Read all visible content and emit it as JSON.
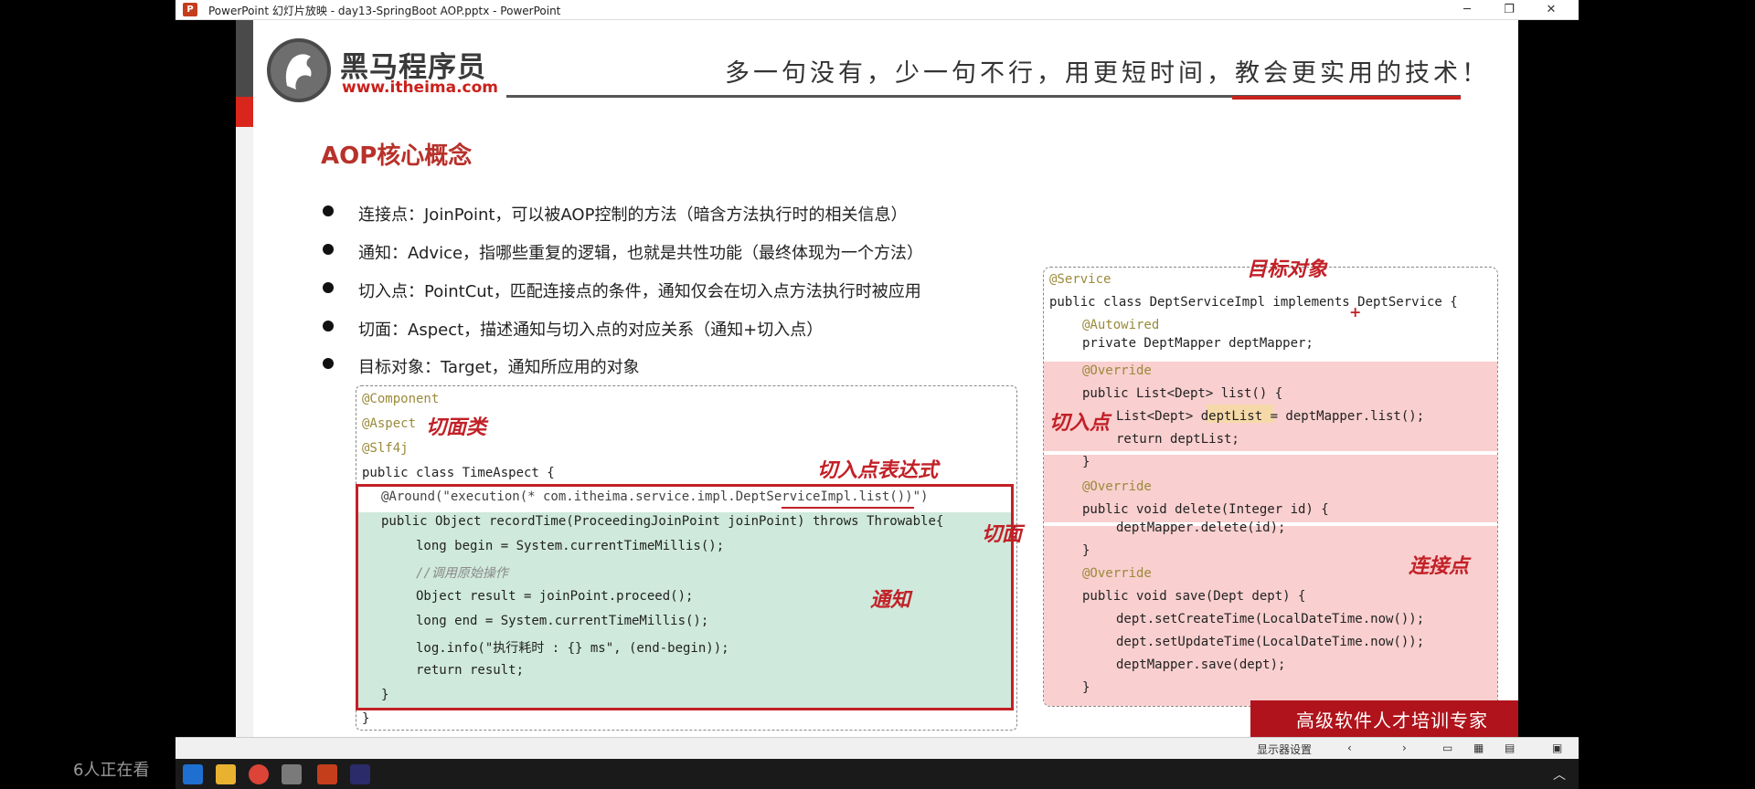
{
  "window": {
    "title": "PowerPoint 幻灯片放映  -  day13-SpringBoot AOP.pptx  -  PowerPoint",
    "minimize": "─",
    "restore": "❐",
    "close": "✕"
  },
  "slide": {
    "logo_cn": "黑马程序员",
    "logo_url": "www.itheima.com",
    "slogan": "多一句没有，少一句不行，用更短时间，教会更实用的技术！",
    "heading": "AOP核心概念",
    "bullets": [
      "连接点：JoinPoint，可以被AOP控制的方法（暗含方法执行时的相关信息）",
      "通知：Advice，指哪些重复的逻辑，也就是共性功能（最终体现为一个方法）",
      "切入点：PointCut，匹配连接点的条件，通知仅会在切入点方法执行时被应用",
      "切面：Aspect，描述通知与切入点的对应关系（通知+切入点）",
      "目标对象：Target，通知所应用的对象"
    ],
    "code_left": {
      "lines": [
        "@Component",
        "@Aspect",
        "@Slf4j",
        "public class TimeAspect {",
        "@Around(\"execution(* com.itheima.service.impl.DeptServiceImpl.list())\")",
        "public Object recordTime(ProceedingJoinPoint joinPoint) throws Throwable{",
        "long begin = System.currentTimeMillis();",
        "//调用原始操作",
        "Object result = joinPoint.proceed();",
        "long end = System.currentTimeMillis();",
        "log.info(\"执行耗时 : {} ms\", (end-begin));",
        "return result;",
        "}",
        "}"
      ]
    },
    "code_right": {
      "lines": [
        "@Service",
        "public class DeptServiceImpl implements DeptService {",
        "@Autowired",
        "private DeptMapper deptMapper;",
        "@Override",
        "public List<Dept> list() {",
        "List<Dept> deptList = deptMapper.list();",
        "return deptList;",
        "}",
        "@Override",
        "public void delete(Integer id) {",
        "deptMapper.delete(id);",
        "}",
        "@Override",
        "public void save(Dept dept) {",
        "dept.setCreateTime(LocalDateTime.now());",
        "dept.setUpdateTime(LocalDateTime.now());",
        "deptMapper.save(dept);",
        "}"
      ]
    },
    "annotations": {
      "aspect_class": "切面类",
      "pointcut_expr": "切入点表达式",
      "aspect": "切面",
      "advice": "通知",
      "target": "目标对象",
      "pointcut": "切入点",
      "joinpoint": "连接点",
      "plus": "+"
    },
    "footer_banner": "高级软件人才培训专家"
  },
  "statusbar": {
    "display_settings": "显示器设置"
  },
  "overlay": {
    "viewers": "6人正在看"
  },
  "colors": {
    "brand_red": "#c9211c",
    "heading_red": "#b8312a",
    "advice_green": "#cfe9dc",
    "joinpoint_pink": "#f9cfcf",
    "annotation_red": "#c22027"
  }
}
